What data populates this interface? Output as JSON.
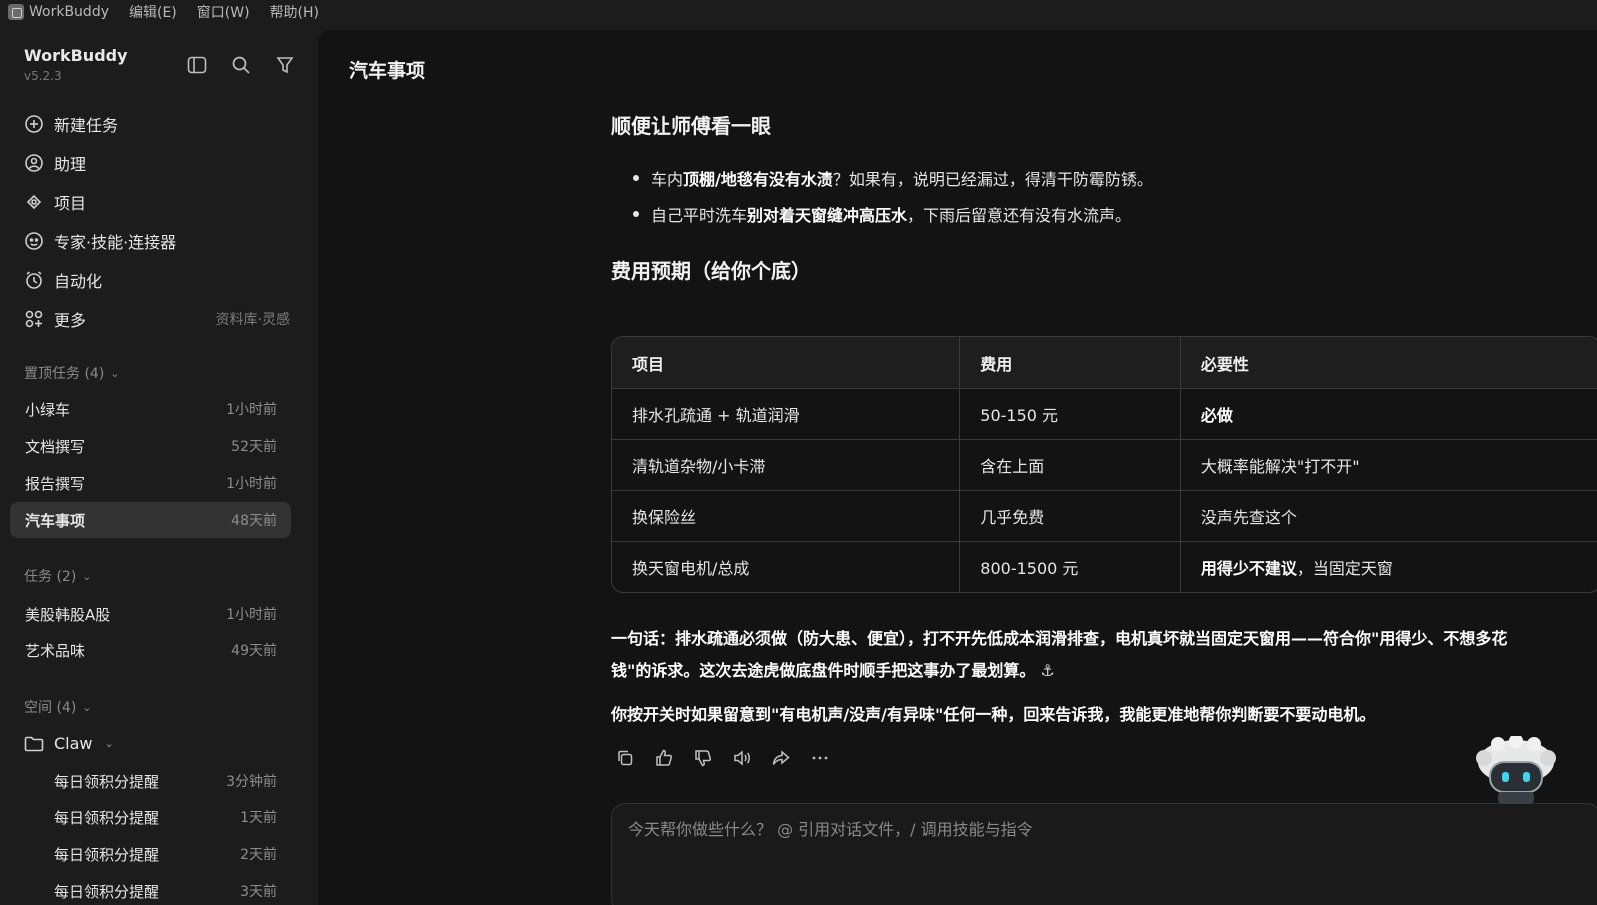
{
  "menubar": {
    "app_name": "WorkBuddy",
    "menus": [
      "编辑(E)",
      "窗口(W)",
      "帮助(H)"
    ]
  },
  "sidebar": {
    "brand": "WorkBuddy",
    "version": "v5.2.3",
    "top_icons": [
      "sidebar-toggle-icon",
      "search-icon",
      "filter-icon"
    ],
    "nav": [
      {
        "label": "新建任务",
        "icon": "plus-circle-icon"
      },
      {
        "label": "助理",
        "icon": "assistant-icon"
      },
      {
        "label": "项目",
        "icon": "project-icon"
      },
      {
        "label": "专家·技能·连接器",
        "icon": "expert-icon"
      },
      {
        "label": "自动化",
        "icon": "alarm-clock-icon"
      },
      {
        "label": "更多",
        "icon": "grid-icon",
        "hint": "资料库·灵感"
      }
    ],
    "pinned_header": "置顶任务 (4)",
    "pinned": [
      {
        "title": "小绿车",
        "time": "1小时前"
      },
      {
        "title": "文档撰写",
        "time": "52天前"
      },
      {
        "title": "报告撰写",
        "time": "1小时前"
      },
      {
        "title": "汽车事项",
        "time": "48天前"
      }
    ],
    "tasks_header": "任务 (2)",
    "tasks": [
      {
        "title": "美股韩股A股",
        "time": "1小时前"
      },
      {
        "title": "艺术品味",
        "time": "49天前"
      }
    ],
    "spaces_header": "空间 (4)",
    "folder": "Claw",
    "folder_items": [
      {
        "title": "每日领积分提醒",
        "time": "3分钟前"
      },
      {
        "title": "每日领积分提醒",
        "time": "1天前"
      },
      {
        "title": "每日领积分提醒",
        "time": "2天前"
      },
      {
        "title": "每日领积分提醒",
        "time": "3天前"
      }
    ]
  },
  "main": {
    "title": "汽车事项",
    "section1_title": "顺便让师傅看一眼",
    "bullet1": {
      "pre": "车内",
      "bold": "顶棚/地毯有没有水渍",
      "post": "？如果有，说明已经漏过，得清干防霉防锈。"
    },
    "bullet2": {
      "pre": "自己平时洗车",
      "bold": "别对着天窗缝冲高压水",
      "post": "，下雨后留意还有没有水流声。"
    },
    "section2_title": "费用预期（给你个底）",
    "table": {
      "headers": [
        "项目",
        "费用",
        "必要性"
      ],
      "rows": [
        [
          "排水孔疏通 + 轨道润滑",
          "50-150 元",
          "必做"
        ],
        [
          "清轨道杂物/小卡滞",
          "含在上面",
          "大概率能解决\"打不开\""
        ],
        [
          "换保险丝",
          "几乎免费",
          "没声先查这个"
        ],
        [
          "换天窗电机/总成",
          "800-1500 元",
          "用得少不建议",
          "，当固定天窗"
        ]
      ]
    },
    "summary_bold": "一句话：",
    "summary_line1": "排水疏通必须做（防大患、便宜），打不开先低成本润滑排查，电机真坏就当固定天窗用——符合你\"用得少、不想多花",
    "summary_line2": "钱\"的诉求。这次去途虎做底盘件时顺手把这事办了最划算。",
    "followup": "你按开关时如果留意到\"有电机声/没声/有异味\"任何一种，回来告诉我，我能更准地帮你判断要不要动电机。",
    "actions": [
      "copy-icon",
      "thumbs-up-icon",
      "thumbs-down-icon",
      "speaker-icon",
      "share-icon",
      "more-icon"
    ],
    "input_placeholder": "今天帮你做些什么？ @ 引用对话文件，/ 调用技能与指令"
  }
}
